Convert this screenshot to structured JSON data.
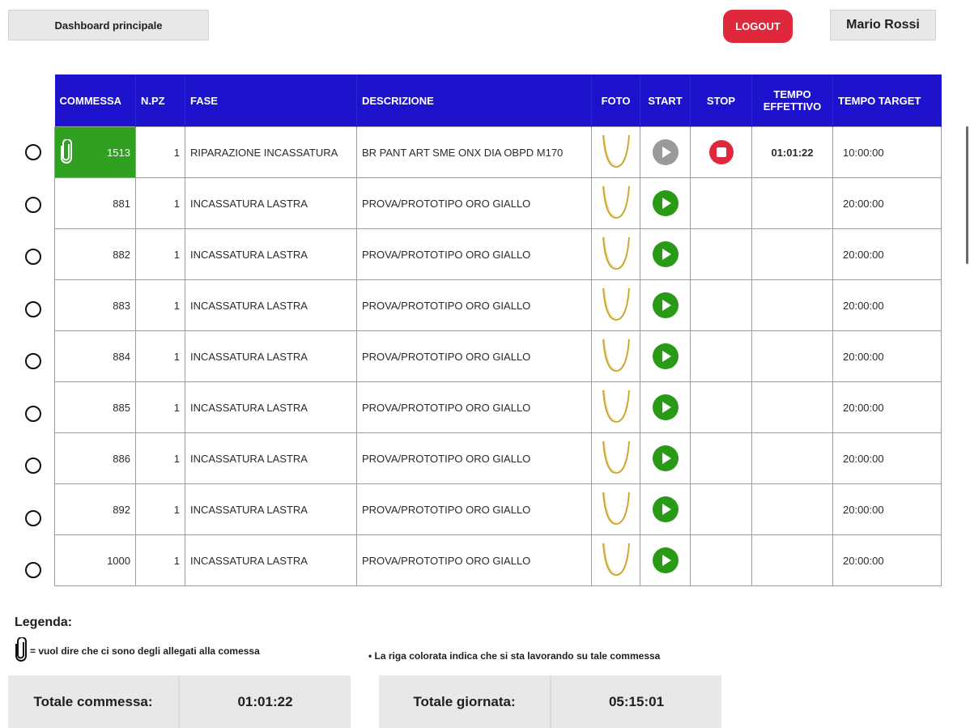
{
  "header": {
    "dashboard_label": "Dashboard principale",
    "logout_label": "LOGOUT",
    "user_name": "Mario Rossi"
  },
  "table": {
    "columns": [
      "COMMESSA",
      "N.PZ",
      "FASE",
      "DESCRIZIONE",
      "FOTO",
      "START",
      "STOP",
      "TEMPO EFFETTIVO",
      "TEMPO TARGET"
    ],
    "rows": [
      {
        "commessa": "1513",
        "npz": "1",
        "fase": "RIPARAZIONE INCASSATURA",
        "descrizione": "BR PANT ART SME ONX DIA OBPD M170",
        "tempo_effettivo": "01:01:22",
        "tempo_target": "10:00:00",
        "active": true
      },
      {
        "commessa": "881",
        "npz": "1",
        "fase": "INCASSATURA LASTRA",
        "descrizione": "PROVA/PROTOTIPO ORO GIALLO",
        "tempo_effettivo": "",
        "tempo_target": "20:00:00",
        "active": false
      },
      {
        "commessa": "882",
        "npz": "1",
        "fase": "INCASSATURA LASTRA",
        "descrizione": "PROVA/PROTOTIPO ORO GIALLO",
        "tempo_effettivo": "",
        "tempo_target": "20:00:00",
        "active": false
      },
      {
        "commessa": "883",
        "npz": "1",
        "fase": "INCASSATURA LASTRA",
        "descrizione": "PROVA/PROTOTIPO ORO GIALLO",
        "tempo_effettivo": "",
        "tempo_target": "20:00:00",
        "active": false
      },
      {
        "commessa": "884",
        "npz": "1",
        "fase": "INCASSATURA LASTRA",
        "descrizione": "PROVA/PROTOTIPO ORO GIALLO",
        "tempo_effettivo": "",
        "tempo_target": "20:00:00",
        "active": false
      },
      {
        "commessa": "885",
        "npz": "1",
        "fase": "INCASSATURA LASTRA",
        "descrizione": "PROVA/PROTOTIPO ORO GIALLO",
        "tempo_effettivo": "",
        "tempo_target": "20:00:00",
        "active": false
      },
      {
        "commessa": "886",
        "npz": "1",
        "fase": "INCASSATURA LASTRA",
        "descrizione": "PROVA/PROTOTIPO ORO GIALLO",
        "tempo_effettivo": "",
        "tempo_target": "20:00:00",
        "active": false
      },
      {
        "commessa": "892",
        "npz": "1",
        "fase": "INCASSATURA LASTRA",
        "descrizione": "PROVA/PROTOTIPO ORO GIALLO",
        "tempo_effettivo": "",
        "tempo_target": "20:00:00",
        "active": false
      },
      {
        "commessa": "1000",
        "npz": "1",
        "fase": "INCASSATURA LASTRA",
        "descrizione": "PROVA/PROTOTIPO ORO GIALLO",
        "tempo_effettivo": "",
        "tempo_target": "20:00:00",
        "active": false
      }
    ]
  },
  "legend": {
    "title": "Legenda:",
    "attachment_text": "= vuol dire che ci sono degli allegati alla comessa",
    "colored_row_text": "• La riga colorata indica che si sta lavorando su tale commessa"
  },
  "totals": {
    "commessa_label": "Totale commessa:",
    "commessa_value": "01:01:22",
    "giornata_label": "Totale giornata:",
    "giornata_value": "05:15:01"
  },
  "icons": {
    "attachment": "paperclip-icon",
    "start": "play-icon",
    "stop": "stop-icon",
    "photo": "necklace-icon"
  },
  "colors": {
    "header_blue": "#1d13cc",
    "active_green": "#2fa01f",
    "start_green": "#289a16",
    "stop_red": "#e0283d",
    "logout_red": "#e0283d",
    "disabled_grey": "#9a9a9a",
    "necklace_gold": "#c9a227"
  }
}
